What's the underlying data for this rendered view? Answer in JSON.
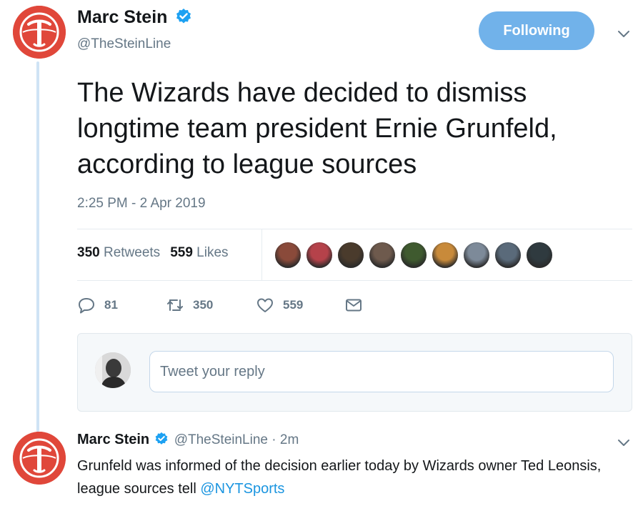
{
  "main_tweet": {
    "author_name": "Marc Stein",
    "author_handle": "@TheSteinLine",
    "follow_label": "Following",
    "text": "The Wizards have decided to dismiss longtime team president Ernie Grunfeld, according to league sources",
    "timestamp": "2:25 PM - 2 Apr 2019",
    "stats": {
      "retweets_count": "350",
      "retweets_label": "Retweets",
      "likes_count": "559",
      "likes_label": "Likes"
    },
    "actions": {
      "reply_count": "81",
      "retweet_count": "350",
      "like_count": "559"
    },
    "liked_by_avatar_colors": [
      "#8a4a3a",
      "#b5424a",
      "#4a3b2c",
      "#6e5a4d",
      "#3f5a2f",
      "#c88a3a",
      "#7d8a99",
      "#5a6a7a",
      "#2f3a3f"
    ]
  },
  "reply_composer": {
    "placeholder": "Tweet your reply"
  },
  "thread_reply": {
    "author_name": "Marc Stein",
    "author_handle": "@TheSteinLine",
    "age": "· 2m",
    "text": "Grunfeld was informed of the decision earlier today by Wizards owner Ted Leonsis, league sources tell ",
    "mention": "@NYTSports"
  },
  "icons": {
    "avatar": "nyt-t-logo",
    "verified": "verified-badge-icon",
    "menu": "chevron-down-icon",
    "reply": "reply-icon",
    "retweet": "retweet-icon",
    "like": "heart-icon",
    "dm": "envelope-icon"
  },
  "colors": {
    "accent": "#1da1f2",
    "follow_button": "#71b2ea",
    "avatar_red": "#e0473a",
    "muted_text": "#657786"
  }
}
